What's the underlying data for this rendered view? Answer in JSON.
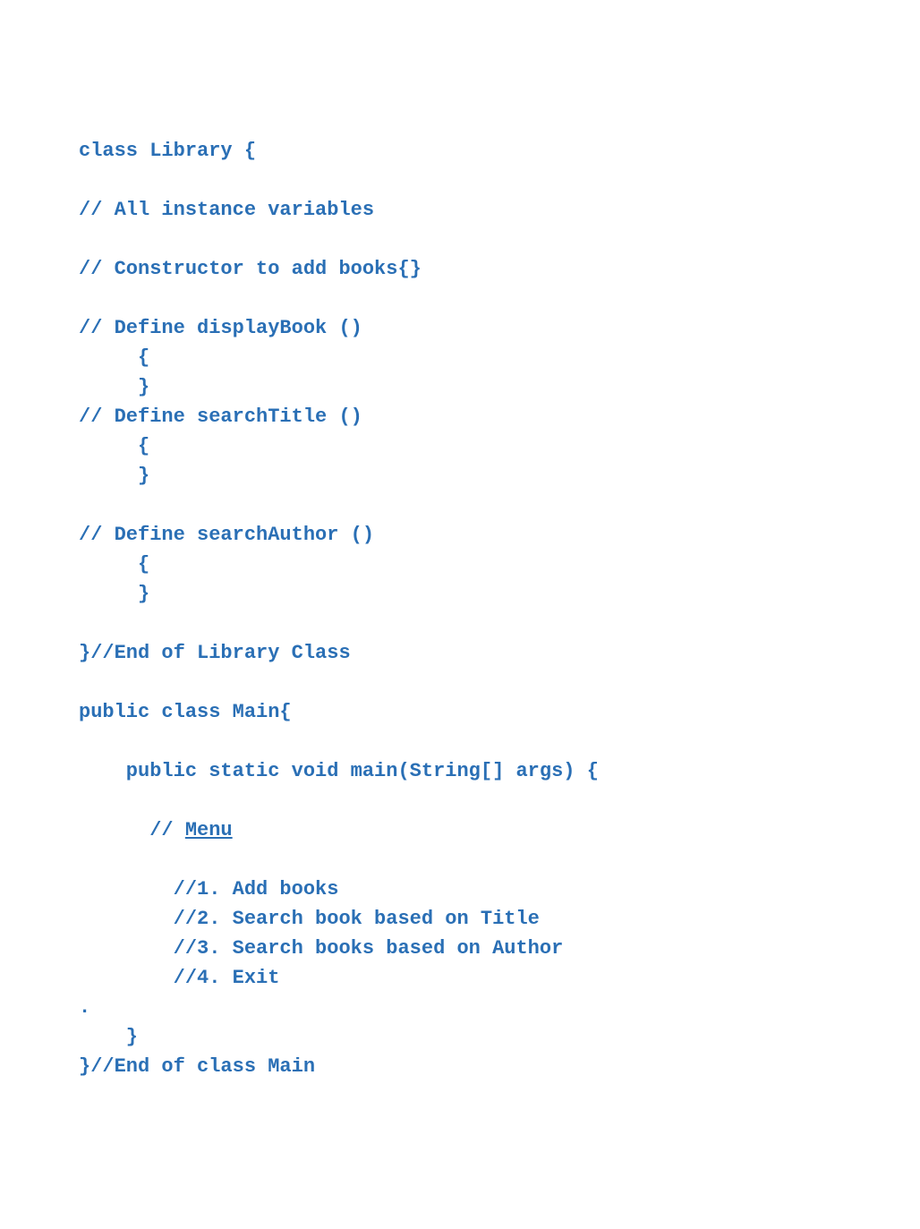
{
  "code": {
    "l1": "class Library {",
    "l2": "",
    "l3": "// All instance variables",
    "l4": "",
    "l5": "// Constructor to add books{}",
    "l6": "",
    "l7": "// Define displayBook ()",
    "l8": "     {",
    "l9": "     }",
    "l10": "// Define searchTitle ()",
    "l11": "     {",
    "l12": "     }",
    "l13": "",
    "l14": "// Define searchAuthor ()",
    "l15": "     {",
    "l16": "     }",
    "l17": "",
    "l18": "}//End of Library Class",
    "l19": "",
    "l20": "public class Main{",
    "l21": "",
    "l22": "    public static void main(String[] args) {",
    "l23": "",
    "l24a": "      // ",
    "l24b": "Menu",
    "l25": "",
    "l26": "        //1. Add books",
    "l27": "        //2. Search book based on Title",
    "l28": "        //3. Search books based on Author",
    "l29": "        //4. Exit",
    "l30": ".",
    "l31": "    }",
    "l32": "}//End of class Main"
  }
}
